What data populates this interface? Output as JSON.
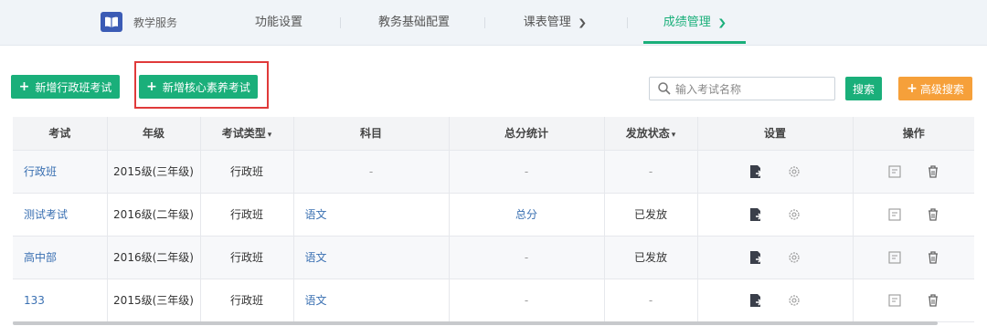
{
  "brand": {
    "label": "教学服务",
    "logo_icon": "book-icon",
    "logo_color": "#3b5bb5"
  },
  "nav": {
    "items": [
      {
        "label": "功能设置",
        "dropdown": false,
        "active": false
      },
      {
        "label": "教务基础配置",
        "dropdown": false,
        "active": false
      },
      {
        "label": "课表管理",
        "dropdown": true,
        "active": false
      },
      {
        "label": "成绩管理",
        "dropdown": true,
        "active": true
      }
    ],
    "active_color": "#1aaf7a"
  },
  "toolbar": {
    "add_admin_exam": "新增行政班考试",
    "add_core_exam": "新增核心素养考试",
    "search_placeholder": "输入考试名称",
    "search_button": "搜索",
    "advanced_search": "高级搜索",
    "primary_color": "#1aaf7a",
    "secondary_color": "#f6a03a",
    "highlight_color": "#e03a3a"
  },
  "table": {
    "headers": [
      "考试",
      "年级",
      "考试类型",
      "科目",
      "总分统计",
      "发放状态",
      "设置",
      "操作"
    ],
    "sortable_headers": {
      "exam_type": true,
      "release_status": true
    },
    "rows": [
      {
        "exam": "行政班",
        "grade": "2015级(三年级)",
        "type": "行政班",
        "subject": "-",
        "total": "-",
        "status": "-"
      },
      {
        "exam": "测试考试",
        "grade": "2016级(二年级)",
        "type": "行政班",
        "subject": "语文",
        "total": "总分",
        "status": "已发放"
      },
      {
        "exam": "高中部",
        "grade": "2016级(二年级)",
        "type": "行政班",
        "subject": "语文",
        "total": "-",
        "status": "已发放"
      },
      {
        "exam": "133",
        "grade": "2015级(三年级)",
        "type": "行政班",
        "subject": "语文",
        "total": "-",
        "status": "-"
      }
    ],
    "settings_icons": [
      "edit-doc-icon",
      "gear-icon"
    ],
    "action_icons": [
      "report-icon",
      "trash-icon"
    ],
    "link_color": "#3a70b2"
  }
}
